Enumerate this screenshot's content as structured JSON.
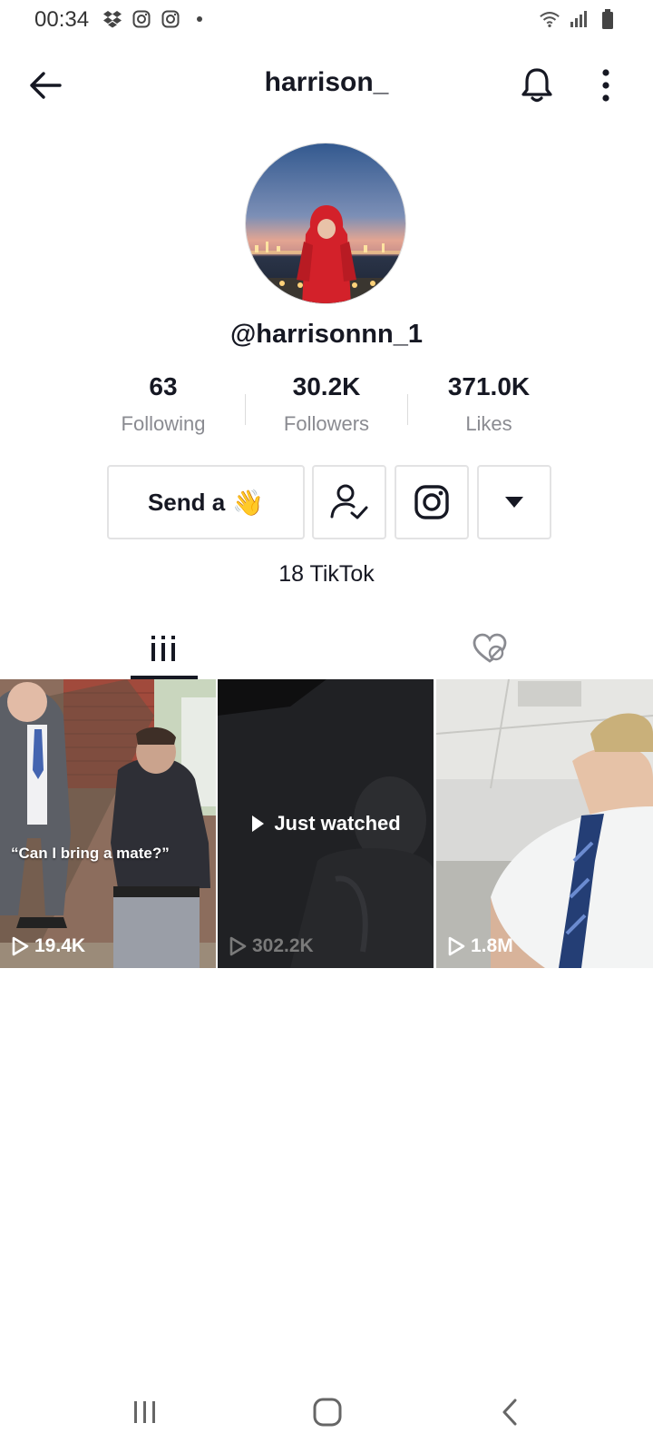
{
  "status_bar": {
    "time": "00:34",
    "left_icons": [
      "dropbox-icon",
      "instagram-icon",
      "instagram-icon",
      "dot-icon"
    ],
    "right_icons": [
      "wifi-icon",
      "signal-icon",
      "battery-icon"
    ]
  },
  "header": {
    "title": "harrison_",
    "back_icon": "back-arrow-icon",
    "bell_icon": "bell-icon",
    "more_icon": "more-vertical-icon"
  },
  "profile": {
    "username": "@harrisonnn_1",
    "stats": [
      {
        "value": "63",
        "label": "Following"
      },
      {
        "value": "30.2K",
        "label": "Followers"
      },
      {
        "value": "371.0K",
        "label": "Likes"
      }
    ],
    "send_button_label": "Send a",
    "send_button_emoji": "👋",
    "bio": "18 TikTok"
  },
  "tabs": [
    {
      "icon": "videos-grid-icon",
      "active": true
    },
    {
      "icon": "liked-hidden-icon",
      "active": false
    }
  ],
  "videos": [
    {
      "views": "19.4K",
      "caption": "“Can I bring a mate?”",
      "overlay": ""
    },
    {
      "views": "302.2K",
      "caption": "",
      "overlay": "Just watched"
    },
    {
      "views": "1.8M",
      "caption": "",
      "overlay": ""
    }
  ],
  "colors": {
    "text_primary": "#161823",
    "text_secondary": "#8a8b91",
    "border": "#e3e3e4"
  }
}
